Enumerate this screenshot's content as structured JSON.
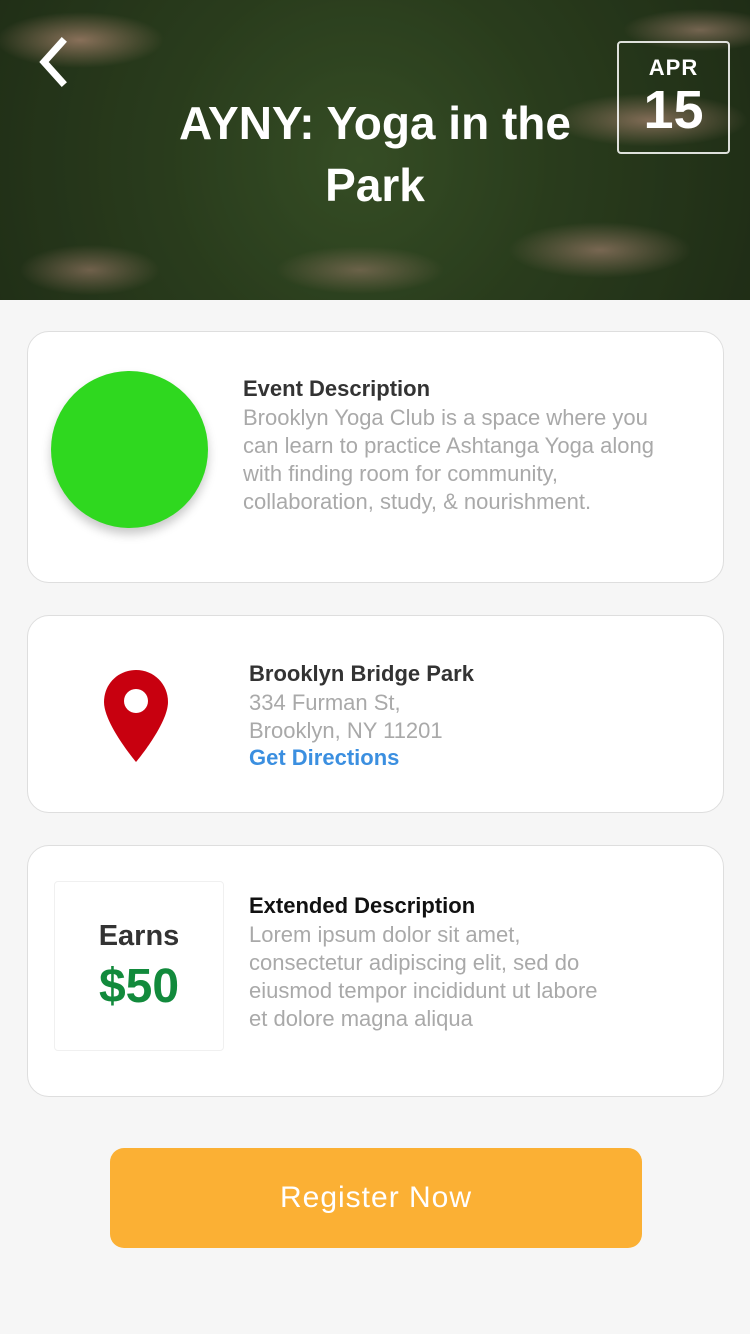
{
  "header": {
    "title": "AYNY: Yoga in the Park",
    "date_month": "APR",
    "date_day": "15",
    "back_icon": "chevron-left-icon"
  },
  "description_card": {
    "title": "Event Description",
    "body": "Brooklyn Yoga Club is a space where you can learn to practice Ashtanga Yoga along with finding room for community, collaboration, study,  & nourishment.",
    "avatar_color": "#2fd81f"
  },
  "location_card": {
    "icon": "map-pin-icon",
    "icon_color": "#c8000f",
    "venue": "Brooklyn Bridge Park",
    "address_line1": "334 Furman St,",
    "address_line2": "Brooklyn, NY 11201",
    "directions_label": "Get Directions",
    "directions_color": "#3b8fe0"
  },
  "extended_card": {
    "earns_label": "Earns",
    "earns_amount": "$50",
    "earns_color": "#128a3c",
    "title": "Extended Description",
    "body": "Lorem ipsum dolor sit amet, consectetur adipiscing elit, sed do eiusmod tempor incididunt ut labore et dolore magna aliqua"
  },
  "actions": {
    "register_label": "Register Now",
    "register_color": "#fbb034"
  }
}
